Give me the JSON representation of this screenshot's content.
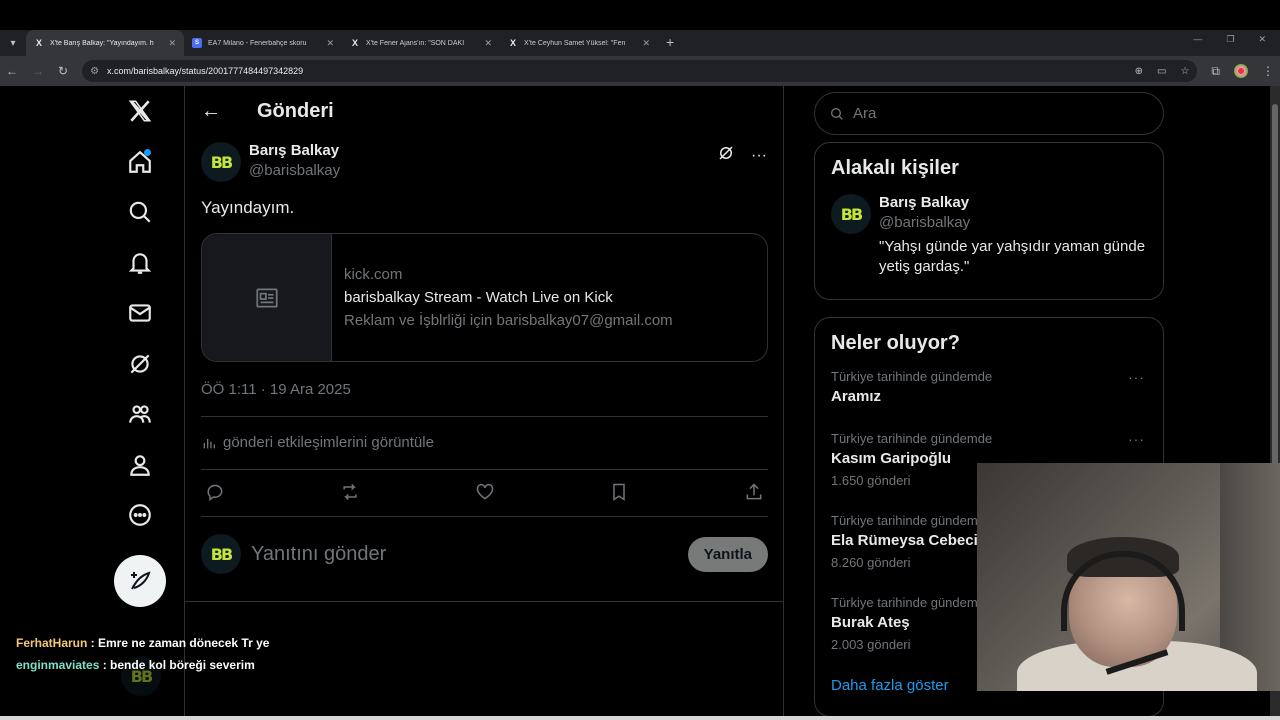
{
  "browser": {
    "tabs": [
      {
        "title": "X'te Barış Balkay: \"Yayındayım. h",
        "icon": "x-icon",
        "active": true
      },
      {
        "title": "EA7 Milano - Fenerbahçe skoru",
        "icon": "ea-icon",
        "active": false
      },
      {
        "title": "X'te Fener Ajans'ın: \"SON DAKİ",
        "icon": "x-icon",
        "active": false
      },
      {
        "title": "X'te Ceyhun Samet Yüksel: \"Fen",
        "icon": "x-icon",
        "active": false
      }
    ],
    "url": "x.com/barisbalkay/status/2001777484497342829"
  },
  "post": {
    "header_title": "Gönderi",
    "author_name": "Barış Balkay",
    "author_handle": "@barisbalkay",
    "avatar_text": "BB",
    "text": "Yayındayım.",
    "card": {
      "domain": "kick.com",
      "title": "barisbalkay Stream - Watch Live on Kick",
      "description": "Reklam ve İşblrliği için barisbalkay07@gmail.com"
    },
    "timestamp": "ÖÖ 1:11 · 19 Ara 2025",
    "analytics_label": "gönderi etkileşimlerini görüntüle",
    "reply_placeholder": "Yanıtını gönder",
    "reply_button": "Yanıtla"
  },
  "sidebar": {
    "search_placeholder": "Ara",
    "related_title": "Alakalı kişiler",
    "related_person": {
      "name": "Barış Balkay",
      "handle": "@barisbalkay",
      "bio": "\"Yahşı günde yar yahşıdır yaman günde yetiş gardaş.\""
    },
    "trends_title": "Neler oluyor?",
    "trends": [
      {
        "context": "Türkiye tarihinde gündemde",
        "name": "Aramız",
        "count": ""
      },
      {
        "context": "Türkiye tarihinde gündemde",
        "name": "Kasım Garipoğlu",
        "count": "1.650 gönderi"
      },
      {
        "context": "Türkiye tarihinde gündemde",
        "name": "Ela Rümeysa Cebeci",
        "count": "8.260 gönderi"
      },
      {
        "context": "Türkiye tarihinde gündemde",
        "name": "Burak Ateş",
        "count": "2.003 gönderi"
      }
    ],
    "show_more": "Daha fazla göster"
  },
  "chat": [
    {
      "user": "FerhatHarun",
      "message": " : Emre ne zaman dönecek Tr ye"
    },
    {
      "user": "enginmaviates",
      "message": " : bende kol böreği severim"
    }
  ],
  "colors": {
    "accent": "#1d9bf0",
    "background": "#000000",
    "avatar_green": "#c6e43a"
  }
}
